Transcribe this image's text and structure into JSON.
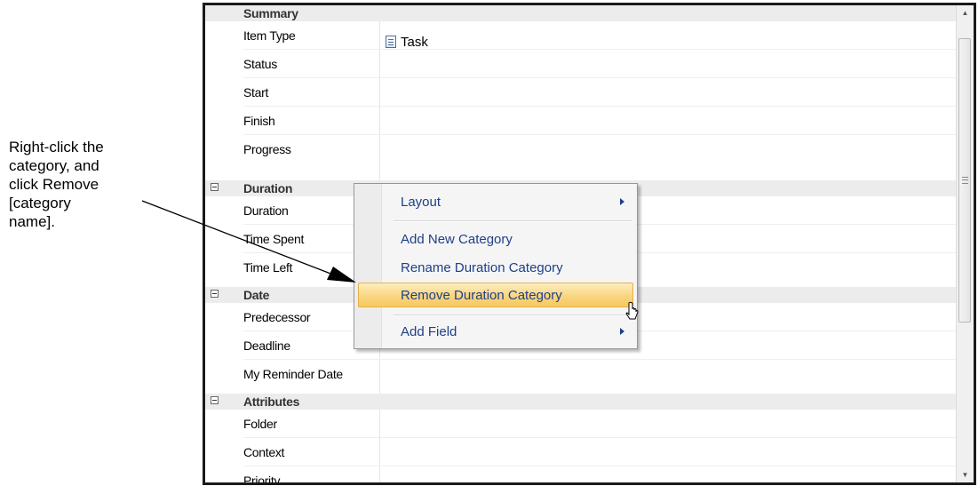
{
  "callout": {
    "text": "Right-click the\ncategory, and\nclick Remove\n[category\nname]."
  },
  "grid": {
    "rows": [
      {
        "type": "category",
        "label": "Summary",
        "collapsible": false
      },
      {
        "type": "field",
        "label": "Item Type",
        "value": "Task"
      },
      {
        "type": "field",
        "label": "Status"
      },
      {
        "type": "field",
        "label": "Start"
      },
      {
        "type": "field",
        "label": "Finish"
      },
      {
        "type": "field",
        "label": "Progress"
      },
      {
        "type": "category",
        "label": "Duration",
        "collapsible": true
      },
      {
        "type": "field",
        "label": "Duration"
      },
      {
        "type": "field",
        "label": "Time Spent"
      },
      {
        "type": "field",
        "label": "Time Left"
      },
      {
        "type": "category",
        "label": "Date",
        "collapsible": true
      },
      {
        "type": "field",
        "label": "Predecessor"
      },
      {
        "type": "field",
        "label": "Deadline"
      },
      {
        "type": "field",
        "label": "My Reminder Date"
      },
      {
        "type": "category",
        "label": "Attributes",
        "collapsible": true
      },
      {
        "type": "field",
        "label": "Folder"
      },
      {
        "type": "field",
        "label": "Context"
      },
      {
        "type": "field",
        "label": "Priority"
      }
    ],
    "item_type_value": "Task"
  },
  "context_menu": {
    "items": [
      {
        "label": "Layout",
        "submenu": true
      },
      {
        "label": "Add New Category",
        "submenu": false
      },
      {
        "label": "Rename Duration Category",
        "submenu": false
      },
      {
        "label": "Remove Duration Category",
        "submenu": false,
        "highlighted": true
      },
      {
        "label": "Add Field",
        "submenu": true
      }
    ]
  },
  "colors": {
    "menu_text": "#1e3f8a",
    "highlight": "#f9d580",
    "category_bg": "#ececec"
  },
  "icons": {
    "task": "task-icon",
    "collapse": "minus-box-icon",
    "submenu": "triangle-right-icon",
    "cursor": "mouse-pointer-icon"
  }
}
